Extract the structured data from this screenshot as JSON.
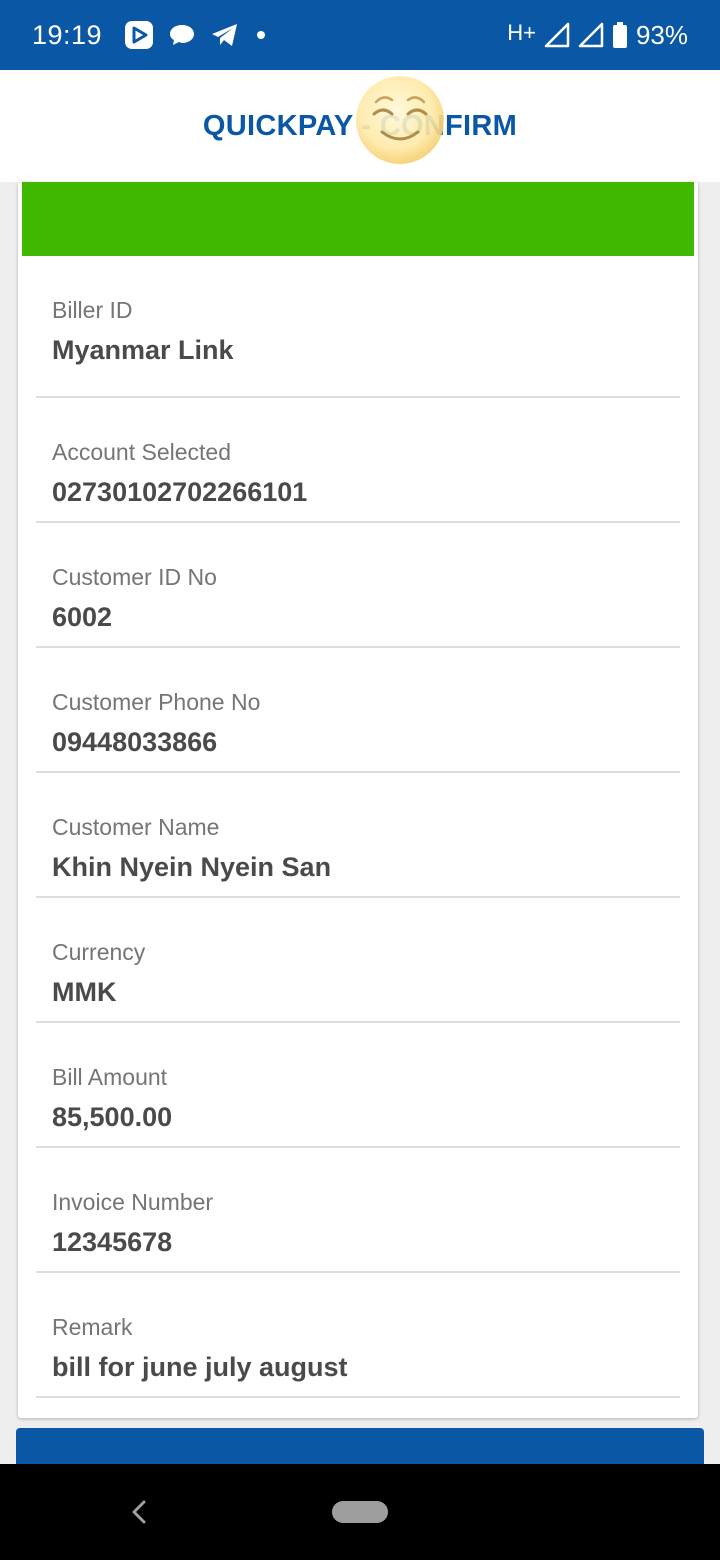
{
  "status_bar": {
    "time": "19:19",
    "network": "H+",
    "battery": "93%"
  },
  "app_bar": {
    "title": "QUICKPAY - CONFIRM"
  },
  "details": [
    {
      "label": "Biller ID",
      "value": "Myanmar Link"
    },
    {
      "label": "Account Selected",
      "value": "02730102702266101"
    },
    {
      "label": "Customer ID No",
      "value": "6002"
    },
    {
      "label": "Customer Phone No",
      "value": "09448033866"
    },
    {
      "label": "Customer Name",
      "value": "Khin Nyein Nyein San"
    },
    {
      "label": "Currency",
      "value": "MMK"
    },
    {
      "label": "Bill Amount",
      "value": "85,500.00"
    },
    {
      "label": "Invoice Number",
      "value": "12345678"
    },
    {
      "label": "Remark",
      "value": "bill for june july august"
    }
  ],
  "colors": {
    "brand_blue": "#0a57a5",
    "banner_green": "#41b800"
  }
}
